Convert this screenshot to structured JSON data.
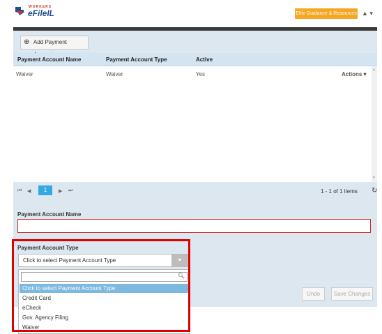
{
  "header": {
    "logo_small_text": "WORKERS",
    "logo_text": "eFileIL",
    "guidance_label": "Efile Guidance & Resources",
    "user_menu_label": "▲ ▾"
  },
  "grid": {
    "add_button_label": "Add Payment Account",
    "columns": [
      "Payment Account Name",
      "Payment Account Type",
      "Active"
    ],
    "rows": [
      {
        "name": "Waiver",
        "type": "Waiver",
        "active": "Yes",
        "actions": "Actions ▾"
      }
    ]
  },
  "pager": {
    "first": "⏮",
    "prev": "◀",
    "page": "1",
    "next": "▶",
    "last": "⏭",
    "info": "1 - 1 of 1 items"
  },
  "form": {
    "name_label": "Payment Account Name",
    "type_label": "Payment Account Type",
    "type_selected": "Click to select Payment Account Type",
    "dropdown_options": [
      "Click to select Payment Account Type",
      "Credit Card",
      "eCheck",
      "Gov. Agency Filing",
      "Waiver"
    ],
    "undo_label": "Undo",
    "save_label": "Save Changes"
  },
  "colors": {
    "accent": "#36a7e0",
    "guidance": "#f5a623",
    "highlight": "#e00000"
  }
}
